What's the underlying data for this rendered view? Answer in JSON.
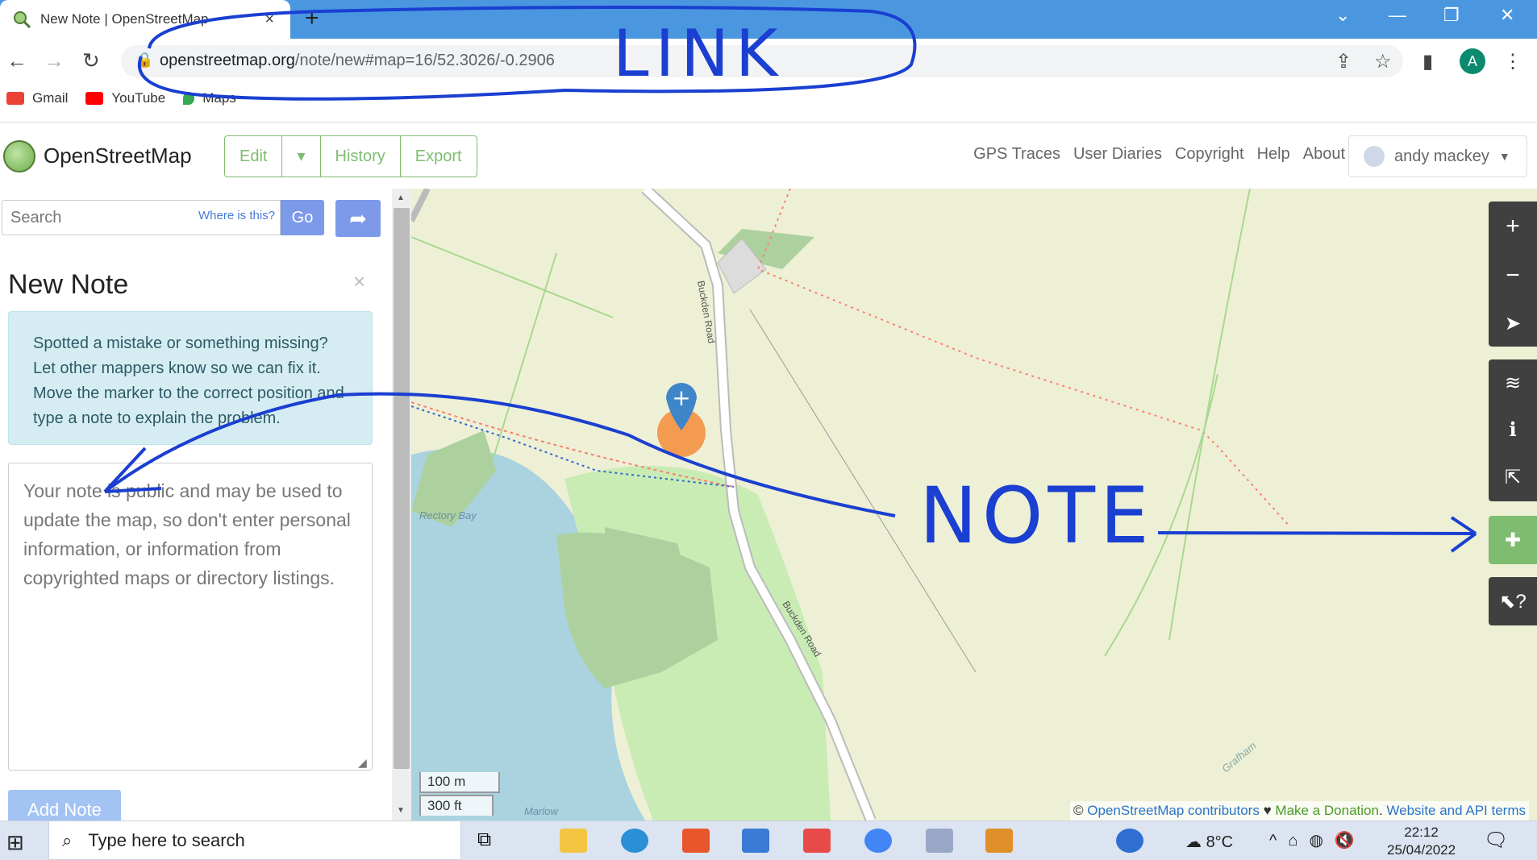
{
  "browser": {
    "tab_title": "New Note | OpenStreetMap",
    "url_host": "openstreetmap.org",
    "url_path": "/note/new#map=16/52.3026/-0.2906",
    "profile_letter": "A",
    "bookmarks": [
      {
        "label": "Gmail",
        "icon": "gmail-icon",
        "color": "#ea4335"
      },
      {
        "label": "YouTube",
        "icon": "youtube-icon",
        "color": "#ff0000"
      },
      {
        "label": "Maps",
        "icon": "maps-icon",
        "color": "#34a853"
      }
    ]
  },
  "osm": {
    "brand": "OpenStreetMap",
    "nav": {
      "edit": "Edit",
      "history": "History",
      "export": "Export"
    },
    "links": [
      "GPS Traces",
      "User Diaries",
      "Copyright",
      "Help",
      "About"
    ],
    "user": "andy mackey"
  },
  "sidebar": {
    "search_placeholder": "Search",
    "where_link": "Where is this?",
    "go_label": "Go",
    "title": "New Note",
    "info": "Spotted a mistake or something missing? Let other mappers know so we can fix it. Move the marker to the correct position and type a note to explain the problem.",
    "note_placeholder": "Your note is public and may be used to update the map, so don't enter personal information, or information from copyrighted maps or directory listings.",
    "add_label": "Add Note"
  },
  "map": {
    "scale_m": "100 m",
    "scale_ft": "300 ft",
    "road_labels": [
      "Buckden Road",
      "Buckden Road"
    ],
    "place_labels": [
      "Rectory Bay",
      "Marlow",
      "Grafham"
    ],
    "attribution": {
      "copy": "©",
      "contributors": "OpenStreetMap contributors",
      "heart": "♥",
      "donate": "Make a Donation",
      "terms": "Website and API terms"
    }
  },
  "annotations": {
    "link": "LINK",
    "note": "NOTE"
  },
  "taskbar": {
    "search_text": "Type here to search",
    "temperature": "8°C",
    "time": "22:12",
    "date": "25/04/2022"
  },
  "colors": {
    "osm_green": "#7ebc6f",
    "annotation_blue": "#1a3fd1",
    "chrome_blue": "#4a97e0"
  }
}
